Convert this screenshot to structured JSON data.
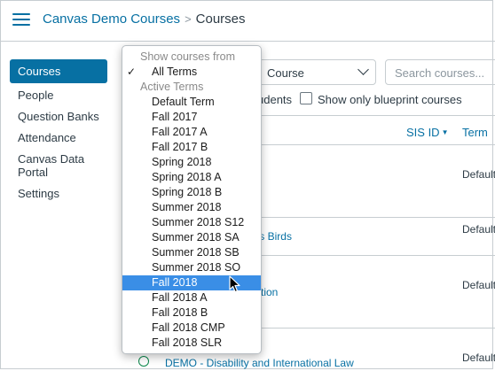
{
  "header": {
    "breadcrumb_link": "Canvas Demo Courses",
    "breadcrumb_separator": ">",
    "breadcrumb_current": "Courses",
    "accent": "#0770a3"
  },
  "sidebar": {
    "items": [
      {
        "label": "Courses"
      },
      {
        "label": "People"
      },
      {
        "label": "Question Banks"
      },
      {
        "label": "Attendance"
      },
      {
        "label": "Canvas Data Portal"
      },
      {
        "label": "Settings"
      }
    ]
  },
  "toolbar": {
    "course_type_value": "Course",
    "search_placeholder": "Search courses...",
    "students_text": "udents",
    "blueprint_label": "Show only blueprint courses"
  },
  "table": {
    "columns": {
      "sis_id": "SIS ID",
      "term": "Term"
    },
    "rows": [
      {
        "course": "",
        "term": "Default Term"
      },
      {
        "course": "'s Birds",
        "term": "Default Term"
      },
      {
        "course": "tion",
        "term": "Default Term"
      },
      {
        "course": "DEMO - Disability and International Law",
        "term": "Default Term"
      }
    ]
  },
  "term_dropdown": {
    "header": "Show courses from",
    "selected_check": "✓",
    "all_terms": "All Terms",
    "group_label": "Active Terms",
    "options": [
      "Default Term",
      "Fall 2017",
      "Fall 2017 A",
      "Fall 2017 B",
      "Spring 2018",
      "Spring 2018 A",
      "Spring 2018 B",
      "Summer 2018",
      "Summer 2018 S12",
      "Summer 2018 SA",
      "Summer 2018 SB",
      "Summer 2018 SO",
      "Fall 2018",
      "Fall 2018 A",
      "Fall 2018 B",
      "Fall 2018 CMP",
      "Fall 2018 SLR"
    ],
    "highlighted": "Fall 2018",
    "highlight_color": "#3a8ee6"
  }
}
